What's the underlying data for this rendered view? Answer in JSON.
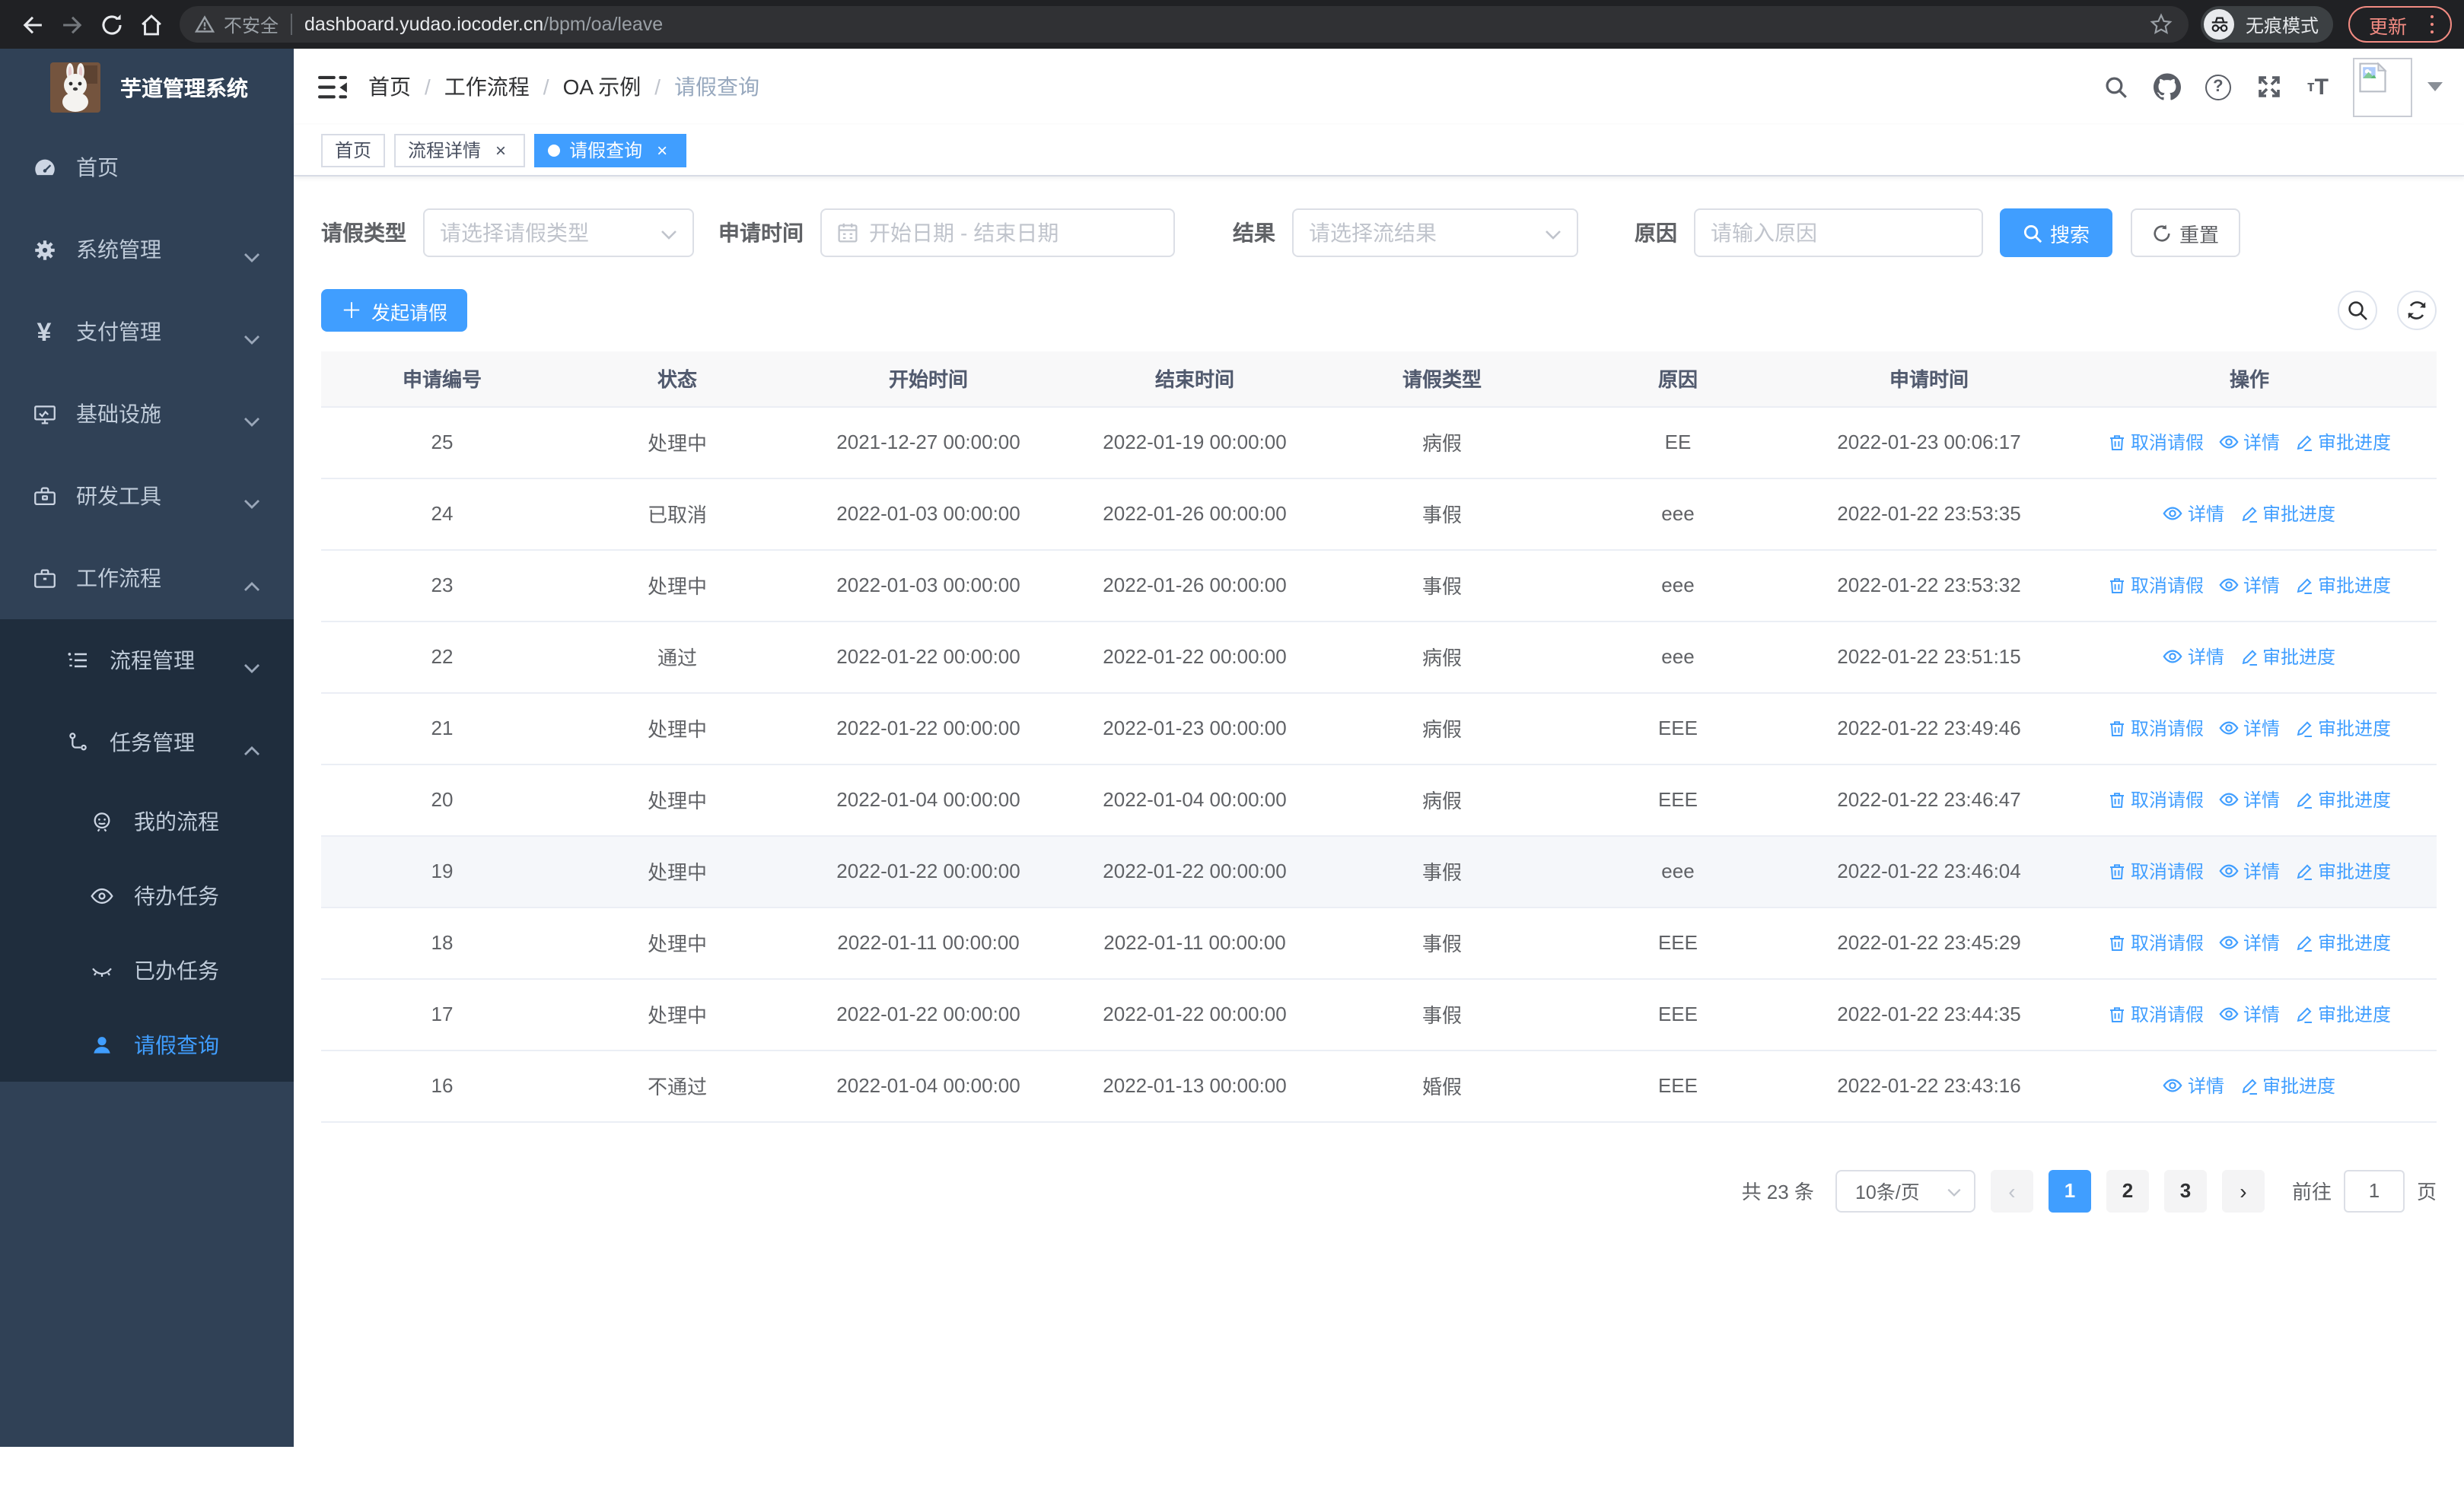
{
  "browser": {
    "security_label": "不安全",
    "url_host": "dashboard.yudao.iocoder.cn",
    "url_path": "/bpm/oa/leave",
    "incognito_label": "无痕模式",
    "update_label": "更新"
  },
  "sidebar": {
    "title": "芋道管理系统",
    "menu": [
      {
        "label": "首页",
        "icon": "dashboard-icon"
      },
      {
        "label": "系统管理",
        "icon": "gear-icon",
        "arrow": "down"
      },
      {
        "label": "支付管理",
        "icon": "yen-icon",
        "arrow": "down"
      },
      {
        "label": "基础设施",
        "icon": "monitor-icon",
        "arrow": "down"
      },
      {
        "label": "研发工具",
        "icon": "toolbox-icon",
        "arrow": "down"
      },
      {
        "label": "工作流程",
        "icon": "briefcase-icon",
        "arrow": "up"
      }
    ],
    "workflow_submenu": [
      {
        "label": "流程管理",
        "icon": "list-tree-icon",
        "arrow": "down"
      },
      {
        "label": "任务管理",
        "icon": "flow-icon",
        "arrow": "up"
      }
    ],
    "task_submenu": [
      {
        "label": "我的流程",
        "icon": "face-icon"
      },
      {
        "label": "待办任务",
        "icon": "eye-open-icon"
      },
      {
        "label": "已办任务",
        "icon": "eye-closed-icon"
      },
      {
        "label": "请假查询",
        "icon": "person-icon",
        "active": true
      }
    ]
  },
  "header": {
    "breadcrumb": [
      "首页",
      "工作流程",
      "OA 示例",
      "请假查询"
    ]
  },
  "tabs": [
    {
      "label": "首页",
      "closable": false,
      "active": false
    },
    {
      "label": "流程详情",
      "closable": true,
      "active": false
    },
    {
      "label": "请假查询",
      "closable": true,
      "active": true
    }
  ],
  "filters": {
    "leave_type_label": "请假类型",
    "leave_type_placeholder": "请选择请假类型",
    "apply_time_label": "申请时间",
    "start_date_placeholder": "开始日期",
    "date_separator": "-",
    "end_date_placeholder": "结束日期",
    "result_label": "结果",
    "result_placeholder": "请选择流结果",
    "reason_label": "原因",
    "reason_placeholder": "请输入原因",
    "search_button": "搜索",
    "reset_button": "重置"
  },
  "toolbar": {
    "create_button": "发起请假"
  },
  "table": {
    "headers": [
      "申请编号",
      "状态",
      "开始时间",
      "结束时间",
      "请假类型",
      "原因",
      "申请时间",
      "操作"
    ],
    "action_labels": {
      "cancel": "取消请假",
      "detail": "详情",
      "progress": "审批进度"
    },
    "rows": [
      {
        "id": "25",
        "status": "处理中",
        "start": "2021-12-27 00:00:00",
        "end": "2022-01-19 00:00:00",
        "type": "病假",
        "reason": "EE",
        "applied": "2022-01-23 00:06:17",
        "actions": [
          "cancel",
          "detail",
          "progress"
        ]
      },
      {
        "id": "24",
        "status": "已取消",
        "start": "2022-01-03 00:00:00",
        "end": "2022-01-26 00:00:00",
        "type": "事假",
        "reason": "eee",
        "applied": "2022-01-22 23:53:35",
        "actions": [
          "detail",
          "progress"
        ]
      },
      {
        "id": "23",
        "status": "处理中",
        "start": "2022-01-03 00:00:00",
        "end": "2022-01-26 00:00:00",
        "type": "事假",
        "reason": "eee",
        "applied": "2022-01-22 23:53:32",
        "actions": [
          "cancel",
          "detail",
          "progress"
        ]
      },
      {
        "id": "22",
        "status": "通过",
        "start": "2022-01-22 00:00:00",
        "end": "2022-01-22 00:00:00",
        "type": "病假",
        "reason": "eee",
        "applied": "2022-01-22 23:51:15",
        "actions": [
          "detail",
          "progress"
        ]
      },
      {
        "id": "21",
        "status": "处理中",
        "start": "2022-01-22 00:00:00",
        "end": "2022-01-23 00:00:00",
        "type": "病假",
        "reason": "EEE",
        "applied": "2022-01-22 23:49:46",
        "actions": [
          "cancel",
          "detail",
          "progress"
        ]
      },
      {
        "id": "20",
        "status": "处理中",
        "start": "2022-01-04 00:00:00",
        "end": "2022-01-04 00:00:00",
        "type": "病假",
        "reason": "EEE",
        "applied": "2022-01-22 23:46:47",
        "actions": [
          "cancel",
          "detail",
          "progress"
        ]
      },
      {
        "id": "19",
        "status": "处理中",
        "start": "2022-01-22 00:00:00",
        "end": "2022-01-22 00:00:00",
        "type": "事假",
        "reason": "eee",
        "applied": "2022-01-22 23:46:04",
        "actions": [
          "cancel",
          "detail",
          "progress"
        ],
        "highlight": true
      },
      {
        "id": "18",
        "status": "处理中",
        "start": "2022-01-11 00:00:00",
        "end": "2022-01-11 00:00:00",
        "type": "事假",
        "reason": "EEE",
        "applied": "2022-01-22 23:45:29",
        "actions": [
          "cancel",
          "detail",
          "progress"
        ]
      },
      {
        "id": "17",
        "status": "处理中",
        "start": "2022-01-22 00:00:00",
        "end": "2022-01-22 00:00:00",
        "type": "事假",
        "reason": "EEE",
        "applied": "2022-01-22 23:44:35",
        "actions": [
          "cancel",
          "detail",
          "progress"
        ]
      },
      {
        "id": "16",
        "status": "不通过",
        "start": "2022-01-04 00:00:00",
        "end": "2022-01-13 00:00:00",
        "type": "婚假",
        "reason": "EEE",
        "applied": "2022-01-22 23:43:16",
        "actions": [
          "detail",
          "progress"
        ]
      }
    ]
  },
  "pagination": {
    "total": "共 23 条",
    "page_size": "10条/页",
    "pages": [
      "1",
      "2",
      "3"
    ],
    "active_page": "1",
    "goto_label": "前往",
    "goto_value": "1",
    "unit_label": "页"
  },
  "icons": {
    "tab_close": "×",
    "create_plus": "＋",
    "vertical_dots": "⋮"
  },
  "colors": {
    "primary": "#409eff",
    "sidebar_bg": "#304156",
    "submenu_bg": "#1f2d3d",
    "sidebar_text": "#bfcbd9",
    "update_accent": "#f28b82",
    "browser_bar": "#202124"
  }
}
